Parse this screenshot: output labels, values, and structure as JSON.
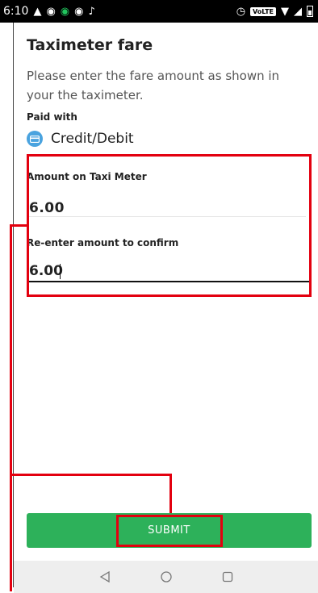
{
  "status_bar": {
    "time": "6:10",
    "volte": "VoLTE"
  },
  "page": {
    "title": "Taximeter fare",
    "description": "Please enter the fare amount as shown in your the taximeter."
  },
  "payment": {
    "label": "Paid with",
    "method": "Credit/Debit",
    "icon": "credit-card-icon"
  },
  "fare": {
    "amount_label": "Amount on Taxi Meter",
    "amount_value": "6.00",
    "confirm_label": "Re-enter amount to confirm",
    "confirm_value": "6.00"
  },
  "actions": {
    "submit_label": "SUBMIT"
  },
  "colors": {
    "accent": "#2db15a",
    "annotation": "#e3000f",
    "card_icon": "#4aa3df"
  }
}
